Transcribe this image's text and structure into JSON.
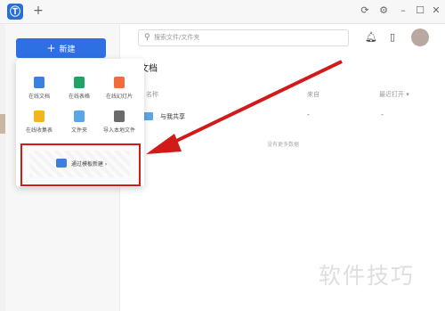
{
  "titlebar": {
    "app_icon": "app-logo-icon",
    "new_tab_label": "+"
  },
  "window_controls": {
    "refresh": "⟳",
    "settings": "⚙",
    "minimize": "–",
    "maximize": "☐",
    "close": "✕"
  },
  "sidebar": {
    "new_button_label": "新建",
    "new_button_icon": "+"
  },
  "search": {
    "placeholder": "搜索文件/文件夹"
  },
  "main": {
    "title": "的文档",
    "columns": {
      "name": "名称",
      "owner": "来自",
      "modified": "最近打开"
    },
    "rows": [
      {
        "name": "与我共享",
        "owner": "-",
        "modified": "-"
      }
    ],
    "empty_hint": "没有更多数据"
  },
  "popup": {
    "items": [
      {
        "label": "在线文档",
        "color": "#3b7fe0"
      },
      {
        "label": "在线表格",
        "color": "#21a366"
      },
      {
        "label": "在线幻灯片",
        "color": "#ef6c3b"
      },
      {
        "label": "在线收集表",
        "color": "#f3b51b"
      },
      {
        "label": "文件夹",
        "color": "#5aa7e8"
      },
      {
        "label": "导入本地文件",
        "color": "#6b6b6b"
      }
    ],
    "template_label": "通过模板新建 ›"
  },
  "watermark": "软件技巧",
  "colors": {
    "accent": "#2f6fe4",
    "highlight": "#d11a1a"
  }
}
